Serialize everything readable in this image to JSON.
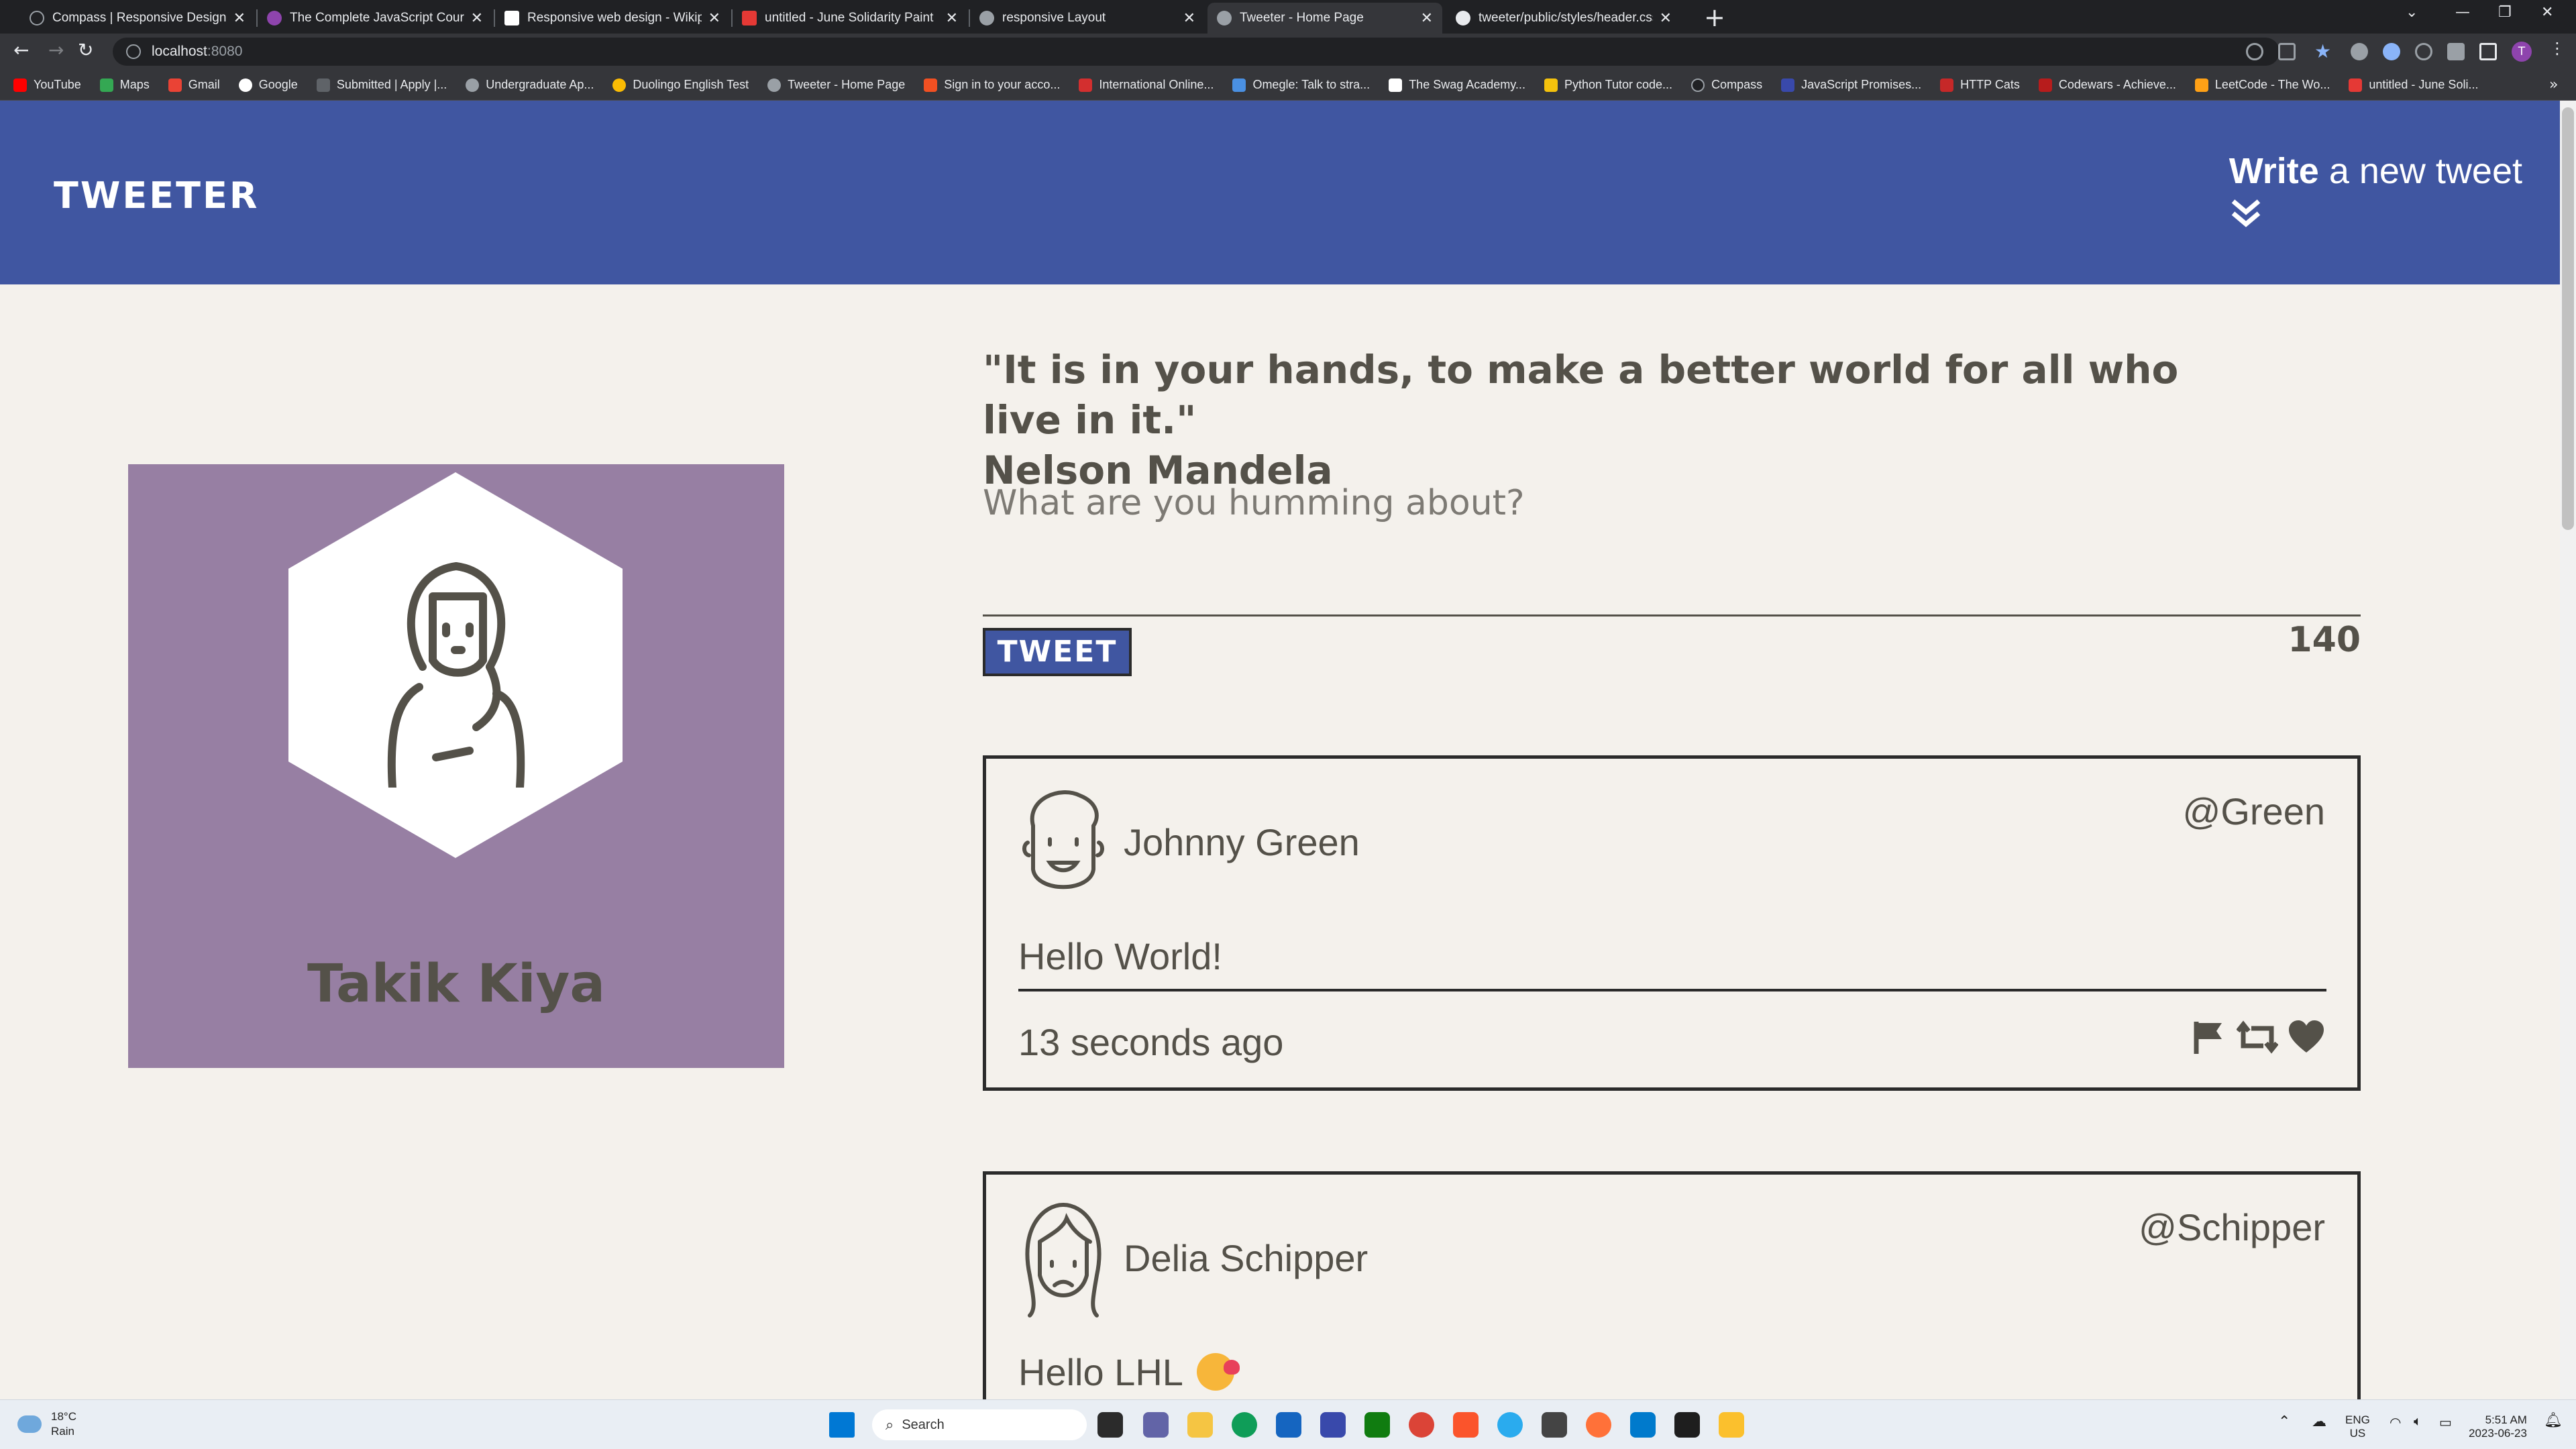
{
  "browser": {
    "tabs": [
      {
        "title": "Compass | Responsive Design",
        "favicon_color": "#202124"
      },
      {
        "title": "The Complete JavaScript Course",
        "favicon_color": "#8e44ad"
      },
      {
        "title": "Responsive web design - Wikipe",
        "favicon_color": "#ffffff"
      },
      {
        "title": "untitled - June Solidarity Paint",
        "favicon_color": "#e53935"
      },
      {
        "title": "responsive Layout",
        "favicon_color": "#9aa0a6"
      },
      {
        "title": "Tweeter - Home Page",
        "favicon_color": "#9aa0a6",
        "active": true
      },
      {
        "title": "tweeter/public/styles/header.css",
        "favicon_color": "#e8eaed"
      }
    ],
    "url_host": "localhost",
    "url_port": ":8080",
    "profile_initial": "T",
    "bookmarks": [
      {
        "label": "YouTube",
        "color": "#ff0000"
      },
      {
        "label": "Maps",
        "color": "#34a853"
      },
      {
        "label": "Gmail",
        "color": "#ea4335"
      },
      {
        "label": "Google",
        "color": "#4285f4"
      },
      {
        "label": "Submitted | Apply |...",
        "color": "#5f6368"
      },
      {
        "label": "Undergraduate Ap...",
        "color": "#9aa0a6"
      },
      {
        "label": "Duolingo English Test",
        "color": "#fbbc04"
      },
      {
        "label": "Tweeter - Home Page",
        "color": "#9aa0a6"
      },
      {
        "label": "Sign in to your acco...",
        "color": "#f25022"
      },
      {
        "label": "International Online...",
        "color": "#d32f2f"
      },
      {
        "label": "Omegle: Talk to stra...",
        "color": "#4a90e2"
      },
      {
        "label": "The Swag Academy...",
        "color": "#ffffff"
      },
      {
        "label": "Python Tutor code...",
        "color": "#f4c20d"
      },
      {
        "label": "Compass",
        "color": "#202124"
      },
      {
        "label": "JavaScript Promises...",
        "color": "#3949ab"
      },
      {
        "label": "HTTP Cats",
        "color": "#c62828"
      },
      {
        "label": "Codewars - Achieve...",
        "color": "#b71c1c"
      },
      {
        "label": "LeetCode - The Wo...",
        "color": "#ffa116"
      },
      {
        "label": "untitled - June Soli...",
        "color": "#e53935"
      }
    ]
  },
  "header": {
    "brand": "TWEETER",
    "compose_bold": "Write",
    "compose_rest": " a new tweet",
    "compose_arrow": "⌄⌄"
  },
  "profile": {
    "name": "Takik Kiya"
  },
  "composer": {
    "quote_line1": "\"It is in your hands, to make a better world for all who live in it.\"",
    "quote_line2": "Nelson Mandela",
    "placeholder": "What are you humming about?",
    "button_label": "TWEET",
    "counter": "140"
  },
  "tweets": [
    {
      "name": "Johnny Green",
      "handle": "@Green",
      "content": "Hello World!",
      "time": "13 seconds ago",
      "avatar": "male"
    },
    {
      "name": "Delia Schipper",
      "handle": "@Schipper",
      "content": "Hello LHL",
      "time": "",
      "avatar": "female"
    }
  ],
  "colors": {
    "nav": "#4056a1",
    "page_bg": "#f4f1ec",
    "profile_card": "#977fa3",
    "text": "#545149"
  },
  "taskbar": {
    "temperature": "18°C",
    "condition": "Rain",
    "search_placeholder": "Search",
    "language_top": "ENG",
    "language_bottom": "US",
    "time": "5:51 AM",
    "date": "2023-06-23"
  }
}
